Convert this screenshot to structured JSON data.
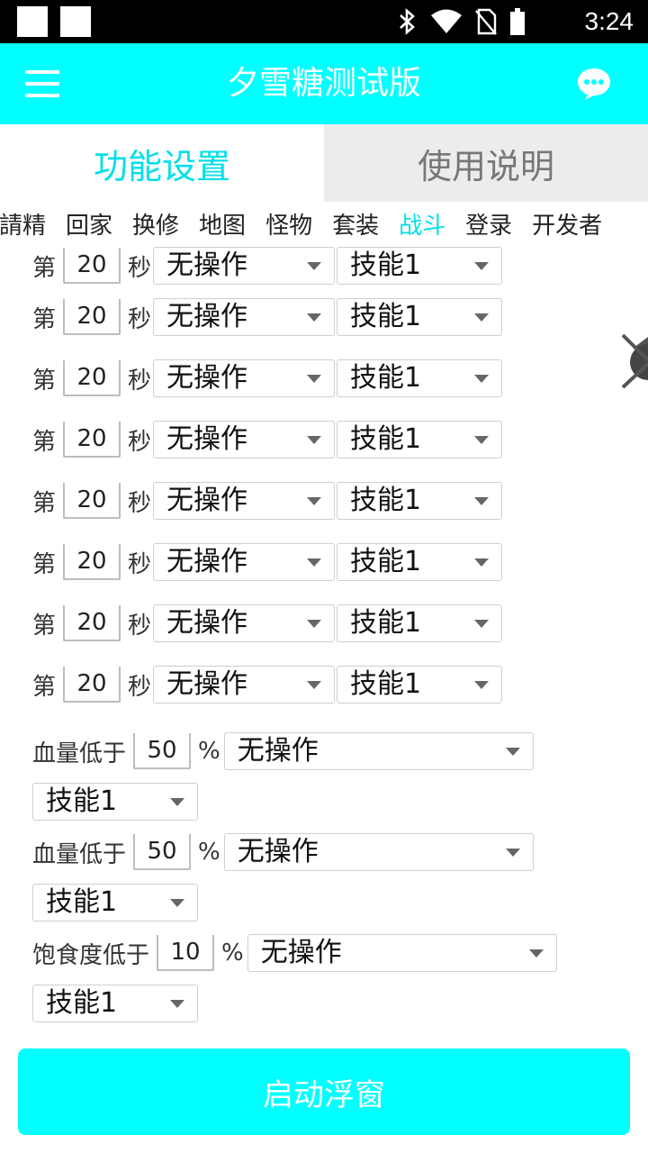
{
  "app": {
    "title": "夕雪糖测试版",
    "accent_color": "#00ffff",
    "icons": {
      "menu": "hamburger-menu-icon",
      "chat": "chat-bubble-icon"
    }
  },
  "statusbar": {
    "time": "3:24",
    "icons": [
      "bluetooth-icon",
      "wifi-icon",
      "no-sim-icon",
      "battery-icon"
    ]
  },
  "tabs": [
    {
      "label": "功能设置",
      "active": true
    },
    {
      "label": "使用说明",
      "active": false
    }
  ],
  "subtabs": [
    {
      "label": "請精",
      "active": false
    },
    {
      "label": "回家",
      "active": false
    },
    {
      "label": "换修",
      "active": false
    },
    {
      "label": "地图",
      "active": false
    },
    {
      "label": "怪物",
      "active": false
    },
    {
      "label": "套装",
      "active": false
    },
    {
      "label": "战斗",
      "active": true
    },
    {
      "label": "登录",
      "active": false
    },
    {
      "label": "开发者",
      "active": false
    }
  ],
  "timed_actions": {
    "prefix": "第",
    "suffix": "秒",
    "rows": [
      {
        "seconds": "20",
        "action": "无操作",
        "skill": "技能1"
      },
      {
        "seconds": "20",
        "action": "无操作",
        "skill": "技能1"
      },
      {
        "seconds": "20",
        "action": "无操作",
        "skill": "技能1"
      },
      {
        "seconds": "20",
        "action": "无操作",
        "skill": "技能1"
      },
      {
        "seconds": "20",
        "action": "无操作",
        "skill": "技能1"
      },
      {
        "seconds": "20",
        "action": "无操作",
        "skill": "技能1"
      },
      {
        "seconds": "20",
        "action": "无操作",
        "skill": "技能1"
      },
      {
        "seconds": "20",
        "action": "无操作",
        "skill": "技能1"
      }
    ]
  },
  "conditions": [
    {
      "label": "血量低于",
      "value": "50",
      "unit": "%",
      "action": "无操作",
      "skill": "技能1"
    },
    {
      "label": "血量低于",
      "value": "50",
      "unit": "%",
      "action": "无操作",
      "skill": "技能1"
    },
    {
      "label": "饱食度低于",
      "value": "10",
      "unit": "%",
      "action": "无操作",
      "skill": "技能1"
    }
  ],
  "start_button": {
    "label": "启动浮窗"
  }
}
